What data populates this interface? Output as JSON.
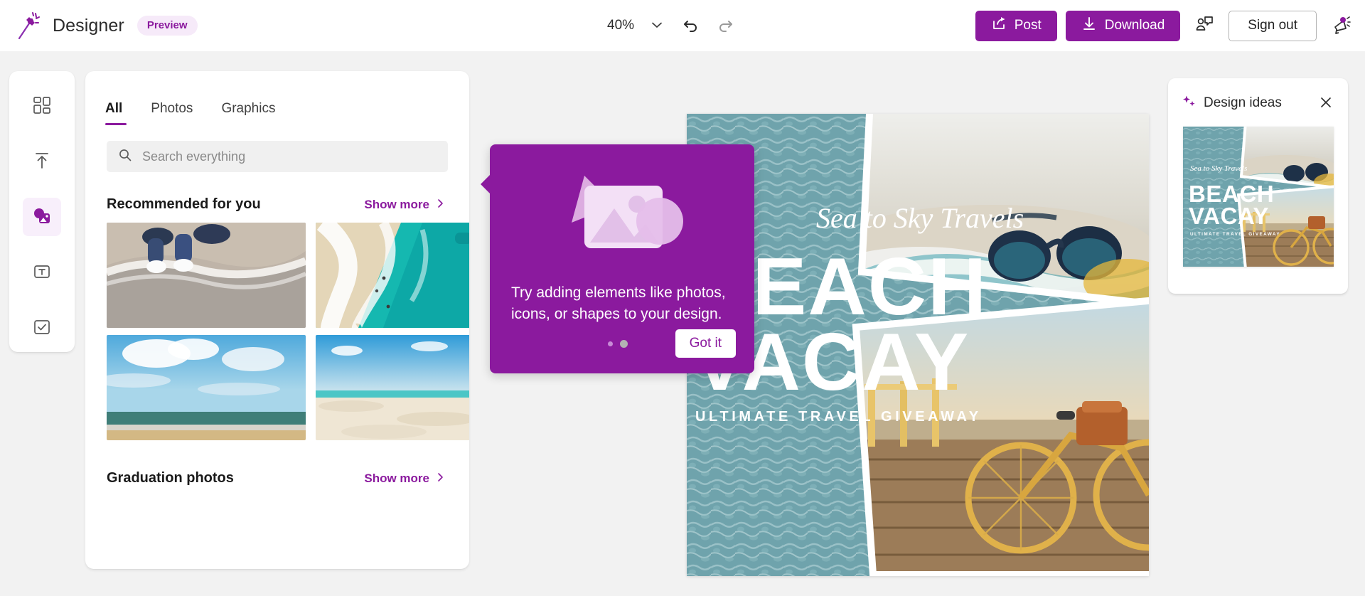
{
  "app": {
    "name": "Designer",
    "preview_badge": "Preview",
    "logo_icon": "magic-wand-icon"
  },
  "toolbar": {
    "zoom_level": "40%",
    "zoom_chevron_icon": "chevron-down-icon",
    "undo_icon": "undo-icon",
    "redo_icon": "redo-icon",
    "post_label": "Post",
    "post_icon": "share-icon",
    "download_label": "Download",
    "download_icon": "download-arrow-icon",
    "feedback_icon": "feedback-person-chat-icon",
    "sign_out_label": "Sign out",
    "announcement_icon": "megaphone-icon",
    "accent_color": "#8B1A9E"
  },
  "rail": {
    "items": [
      {
        "name": "templates",
        "icon": "grid-layout-icon",
        "selected": false
      },
      {
        "name": "upload",
        "icon": "upload-arrow-icon",
        "selected": false
      },
      {
        "name": "media",
        "icon": "media-photos-icon",
        "selected": true
      },
      {
        "name": "text",
        "icon": "text-t-icon",
        "selected": false
      },
      {
        "name": "checklist",
        "icon": "checkbox-check-icon",
        "selected": false
      }
    ],
    "selected_bg": "#F8EFFB"
  },
  "panel": {
    "tabs": [
      {
        "label": "All",
        "active": true
      },
      {
        "label": "Photos",
        "active": false
      },
      {
        "label": "Graphics",
        "active": false
      }
    ],
    "search": {
      "placeholder": "Search everything",
      "value": "",
      "icon": "search-icon"
    },
    "sections": [
      {
        "title": "Recommended for you",
        "show_more": "Show more",
        "chevron_icon": "chevron-right-icon",
        "thumbs": [
          {
            "name": "feet-on-beach-foam-photo"
          },
          {
            "name": "aerial-turquoise-shoreline-photo"
          },
          {
            "name": "cloudy-sky-over-sea-photo"
          },
          {
            "name": "white-sand-beach-photo"
          }
        ]
      },
      {
        "title": "Graduation photos",
        "show_more": "Show more",
        "chevron_icon": "chevron-right-icon",
        "thumbs": []
      }
    ]
  },
  "callout": {
    "body": "Try adding elements like photos, icons, or shapes to your design.",
    "cta_label": "Got it",
    "art_icon": "shapes-and-photo-illustration",
    "dots": 2,
    "active_dot_index": 1,
    "background_color": "#8B1A9E"
  },
  "canvas": {
    "design": {
      "script_line": "Sea to Sky Travels",
      "headline_line1": "BEACH",
      "headline_line2": "VACAY",
      "subline": "ULTIMATE TRAVEL GIVEAWAY",
      "background_color": "#6FA3AC"
    }
  },
  "design_ideas": {
    "title": "Design ideas",
    "sparkle_icon": "sparkles-icon",
    "close_icon": "close-icon",
    "thumbnail": {
      "script_line": "Sea to Sky Travels",
      "headline_line1": "BEACH",
      "headline_line2": "VACAY",
      "subline": "ULTIMATE TRAVEL GIVEAWAY"
    }
  }
}
